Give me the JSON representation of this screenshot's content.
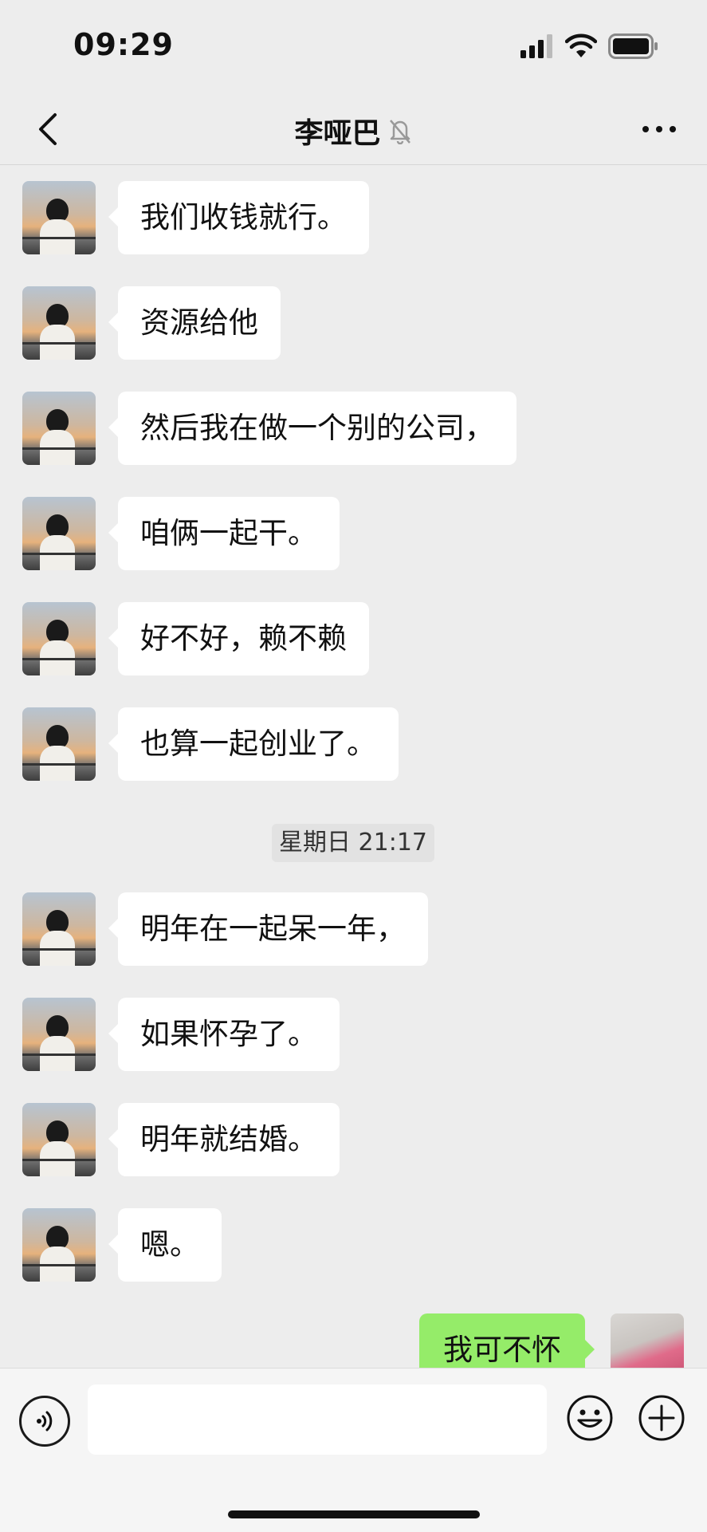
{
  "status_bar": {
    "time": "09:29",
    "signal_icon": "cellular-signal-icon",
    "wifi_icon": "wifi-icon",
    "battery_icon": "battery-icon"
  },
  "nav": {
    "title": "李哑巴",
    "back_icon": "chevron-left-icon",
    "mute_icon": "bell-muted-icon",
    "more_icon": "more-dots-icon"
  },
  "messages_before": [
    {
      "text": "我们收钱就行。"
    },
    {
      "text": "资源给他"
    },
    {
      "text": "然后我在做一个别的公司，"
    },
    {
      "text": "咱俩一起干。"
    },
    {
      "text": "好不好，赖不赖"
    },
    {
      "text": "也算一起创业了。"
    }
  ],
  "time_separator": "星期日 21:17",
  "messages_after": [
    {
      "text": "明年在一起呆一年，"
    },
    {
      "text": "如果怀孕了。"
    },
    {
      "text": "明年就结婚。"
    },
    {
      "text": "嗯。"
    }
  ],
  "self_message": {
    "text": "我可不怀"
  },
  "input_bar": {
    "voice_icon": "voice-input-icon",
    "emoji_icon": "emoji-icon",
    "plus_icon": "plus-icon",
    "value": ""
  },
  "colors": {
    "background": "#ededed",
    "self_bubble": "#95ec69",
    "other_bubble": "#ffffff"
  }
}
